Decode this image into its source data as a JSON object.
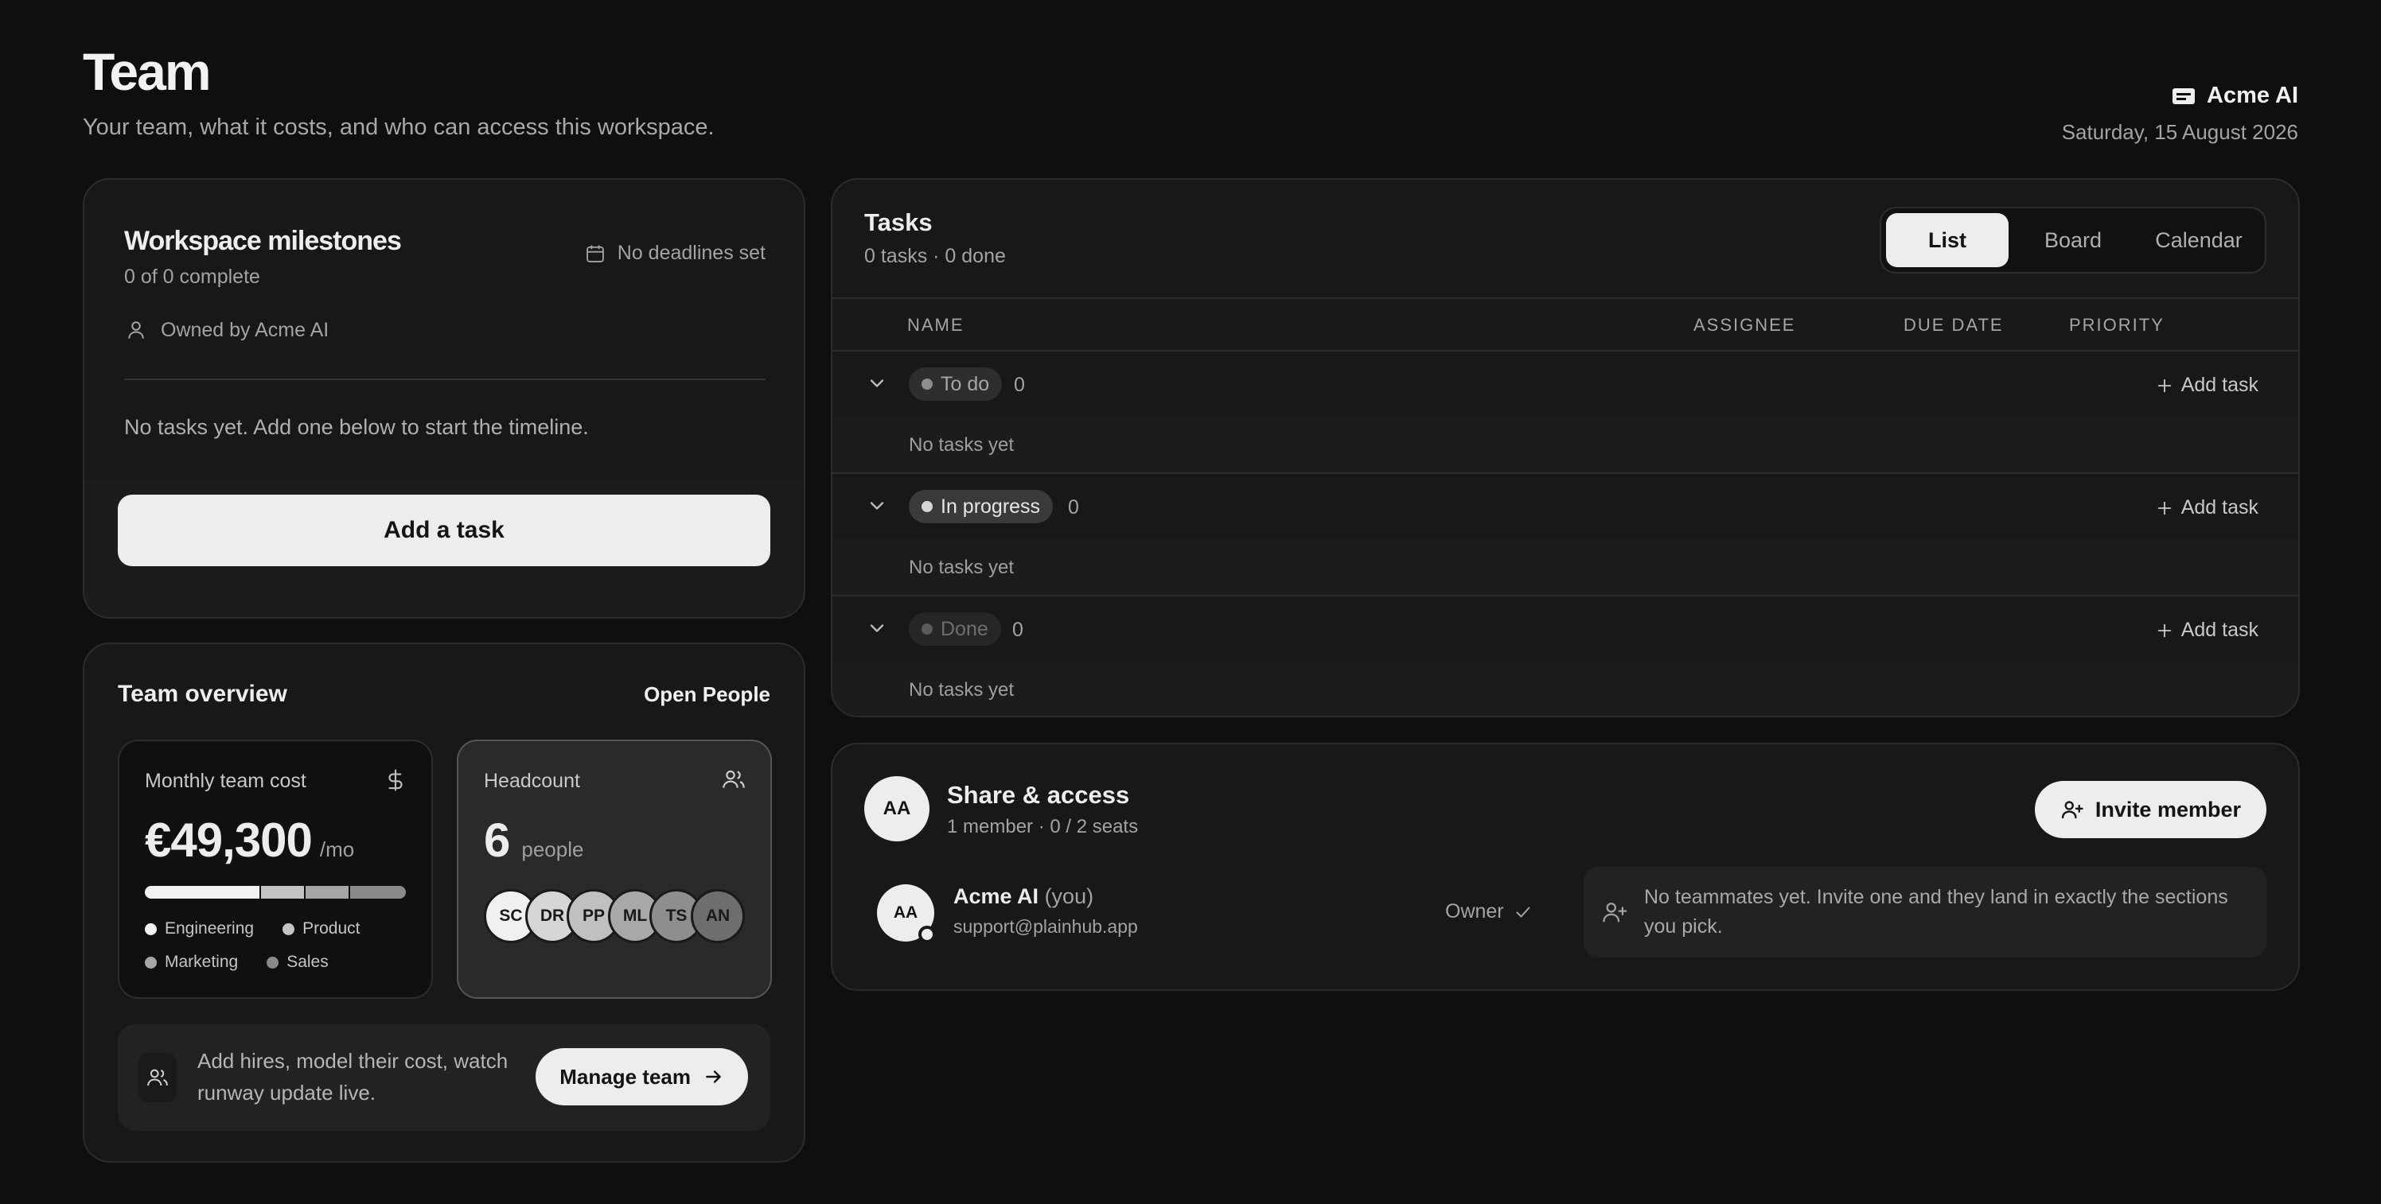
{
  "header": {
    "title": "Team",
    "subtitle": "Your team, what it costs, and who can access this workspace.",
    "org_name": "Acme AI",
    "date": "Saturday, 15 August 2026"
  },
  "milestones": {
    "title": "Workspace milestones",
    "progress": "0 of 0 complete",
    "deadline": "No deadlines set",
    "owner": "Owned by Acme AI",
    "empty": "No tasks yet. Add one below to start the timeline.",
    "add_label": "Add a task"
  },
  "overview": {
    "title": "Team overview",
    "link": "Open People",
    "cost": {
      "label": "Monthly team cost",
      "value": "€49,300",
      "unit": "/mo",
      "breakdown": [
        {
          "name": "Engineering",
          "share": 0.44,
          "color": "#f2f2f2"
        },
        {
          "name": "Product",
          "share": 0.17,
          "color": "#c4c4c4"
        },
        {
          "name": "Marketing",
          "share": 0.17,
          "color": "#a6a6a6"
        },
        {
          "name": "Sales",
          "share": 0.22,
          "color": "#8a8a8a"
        }
      ]
    },
    "headcount": {
      "label": "Headcount",
      "value": "6",
      "unit": "people",
      "members": [
        {
          "initials": "SC",
          "color": "#f0f0f0"
        },
        {
          "initials": "DR",
          "color": "#d6d6d6"
        },
        {
          "initials": "PP",
          "color": "#c0c0c0"
        },
        {
          "initials": "ML",
          "color": "#a8a8a8"
        },
        {
          "initials": "TS",
          "color": "#8e8e8e"
        },
        {
          "initials": "AN",
          "color": "#6e6e6e"
        }
      ]
    },
    "cta_text": "Add hires, model their cost, watch runway update live.",
    "cta_button": "Manage team"
  },
  "tasks": {
    "title": "Tasks",
    "summary": "0 tasks · 0 done",
    "views": [
      "List",
      "Board",
      "Calendar"
    ],
    "active_view": "List",
    "columns": {
      "name": "NAME",
      "assignee": "ASSIGNEE",
      "due": "DUE DATE",
      "priority": "PRIORITY"
    },
    "groups": [
      {
        "label": "To do",
        "count": "0",
        "add": "Add task",
        "empty": "No tasks yet"
      },
      {
        "label": "In progress",
        "count": "0",
        "add": "Add task",
        "empty": "No tasks yet"
      },
      {
        "label": "Done",
        "count": "0",
        "add": "Add task",
        "empty": "No tasks yet"
      }
    ]
  },
  "share": {
    "avatar": "AA",
    "title": "Share & access",
    "summary": "1 member · 0 / 2 seats",
    "invite": "Invite member",
    "member": {
      "initials": "AA",
      "name": "Acme AI",
      "you": "(you)",
      "email": "support@plainhub.app",
      "role": "Owner"
    },
    "note": "No teammates yet. Invite one and they land in exactly the sections you pick."
  }
}
